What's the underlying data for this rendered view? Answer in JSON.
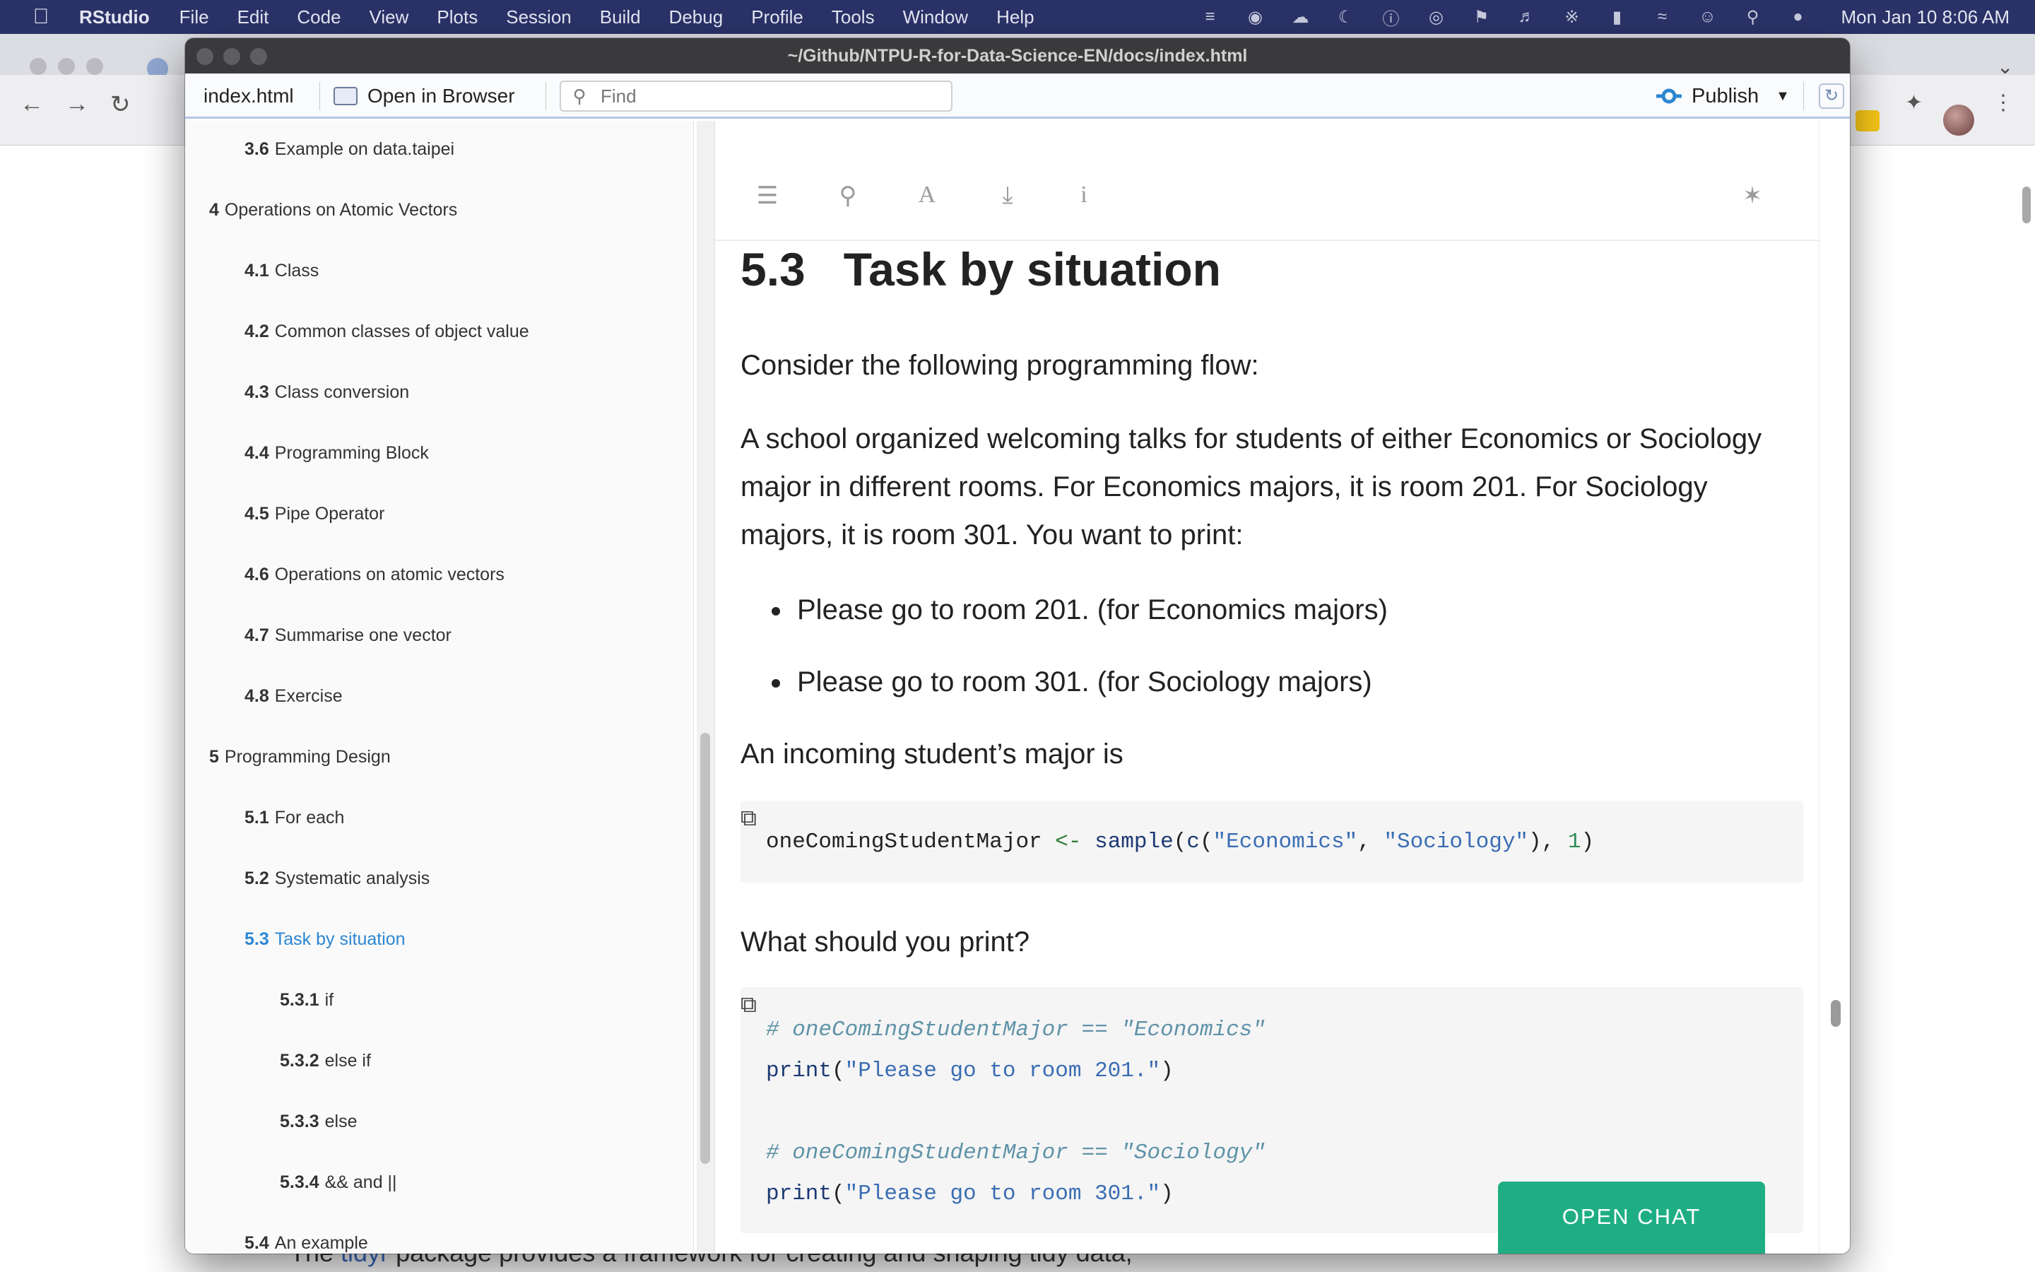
{
  "menubar": {
    "app_name": "RStudio",
    "items": [
      "File",
      "Edit",
      "Code",
      "View",
      "Plots",
      "Session",
      "Build",
      "Debug",
      "Profile",
      "Tools",
      "Window",
      "Help"
    ],
    "clock": "Mon Jan 10  8:06 AM"
  },
  "background_page": {
    "text_before_link": "The ",
    "link_text": "tidyr",
    "text_after_link": " package provides a framework for creating and shaping tidy data,"
  },
  "window": {
    "title": "~/Github/NTPU-R-for-Data-Science-EN/docs/index.html"
  },
  "viewer": {
    "file_tab": "index.html",
    "open_in_browser": "Open in Browser",
    "find_placeholder": "Find",
    "publish_label": "Publish"
  },
  "toc": {
    "entries": [
      {
        "num": "3.6",
        "label": "Example on data.taipei"
      },
      {
        "num": "4",
        "label": "Operations on Atomic Vectors"
      },
      {
        "num": "4.1",
        "label": "Class"
      },
      {
        "num": "4.2",
        "label": "Common classes of object value"
      },
      {
        "num": "4.3",
        "label": "Class conversion"
      },
      {
        "num": "4.4",
        "label": "Programming Block"
      },
      {
        "num": "4.5",
        "label": "Pipe Operator"
      },
      {
        "num": "4.6",
        "label": "Operations on atomic vectors"
      },
      {
        "num": "4.7",
        "label": "Summarise one vector"
      },
      {
        "num": "4.8",
        "label": "Exercise"
      },
      {
        "num": "5",
        "label": "Programming Design"
      },
      {
        "num": "5.1",
        "label": "For each"
      },
      {
        "num": "5.2",
        "label": "Systematic analysis"
      },
      {
        "num": "5.3",
        "label": "Task by situation"
      },
      {
        "num": "5.3.1",
        "label": "if"
      },
      {
        "num": "5.3.2",
        "label": "else if"
      },
      {
        "num": "5.3.3",
        "label": "else"
      },
      {
        "num": "5.3.4",
        "label": "&& and ||"
      },
      {
        "num": "5.4",
        "label": "An example"
      }
    ]
  },
  "content": {
    "section_number": "5.3",
    "section_title": "Task by situation",
    "para1": "Consider the following programming flow:",
    "para2": "A school organized welcoming talks for students of either Economics or Sociology major in different rooms. For Economics majors, it is room 201. For Sociology majors, it is room 301. You want to print:",
    "bullets": [
      "Please go to room 201. (for Economics majors)",
      "Please go to room 301. (for Sociology majors)"
    ],
    "para3": "An incoming student’s major is",
    "code1": {
      "var": "oneComingStudentMajor",
      "assign": " <- ",
      "fn_sample": "sample",
      "paren_open": "(",
      "fn_c": "c",
      "str_econ": "\"Economics\"",
      "comma": ", ",
      "str_soc": "\"Sociology\"",
      "paren_close": ")",
      "num": "1",
      "end": ")"
    },
    "para4": "What should you print?",
    "code2": {
      "comment1": "# oneComingStudentMajor == \"Economics\"",
      "fn_print": "print",
      "str_201": "\"Please go to room 201.\"",
      "comment2": "# oneComingStudentMajor == \"Sociology\"",
      "str_301": "\"Please go to room 301.\""
    }
  },
  "chat": {
    "label": "OPEN CHAT"
  },
  "colors": {
    "menubar_bg": "#2a3268",
    "toc_active": "#2c86d1",
    "chat_button": "#1fae84",
    "code_bg": "#f5f5f5"
  }
}
